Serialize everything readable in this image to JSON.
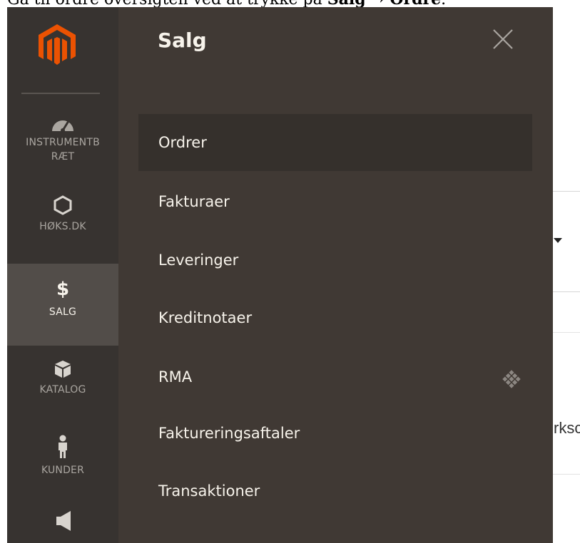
{
  "caption": {
    "text_before": "Gå til ordre oversigten ved at trykke på ",
    "bold_1": "Salg",
    "arrow": " → ",
    "bold_2": "Ordre",
    "period": "."
  },
  "background": {
    "partial_text": "rksc"
  },
  "nav": {
    "logo_icon": "magento-logo",
    "items": [
      {
        "label": "INSTRUMENTBRÆT",
        "line1": "INSTRUMENTB",
        "line2": "RÆT",
        "icon": "dashboard-gauge-icon",
        "active": false
      },
      {
        "label": "HØKS.DK",
        "icon": "hexagon-icon",
        "active": false
      },
      {
        "label": "SALG",
        "icon": "dollar-icon",
        "active": true
      },
      {
        "label": "KATALOG",
        "icon": "box-icon",
        "active": false
      },
      {
        "label": "KUNDER",
        "icon": "person-icon",
        "active": false
      },
      {
        "label": "",
        "icon": "megaphone-icon",
        "active": false
      }
    ]
  },
  "flyout": {
    "title": "Salg",
    "close_icon": "close-icon",
    "items": [
      {
        "label": "Ordrer",
        "active": true
      },
      {
        "label": "Fakturaer",
        "active": false
      },
      {
        "label": "Leveringer",
        "active": false
      },
      {
        "label": "Kreditnotaer",
        "active": false
      },
      {
        "label": "RMA",
        "active": false,
        "badge_icon": "diamond-grid-icon"
      },
      {
        "label": "Faktureringsaftaler",
        "active": false
      },
      {
        "label": "Transaktioner",
        "active": false
      }
    ]
  },
  "colors": {
    "nav_bg": "#373330",
    "nav_active_bg": "#524d49",
    "flyout_bg": "#403934",
    "flyout_active_bg": "#35302c",
    "logo_orange": "#eb5202"
  }
}
